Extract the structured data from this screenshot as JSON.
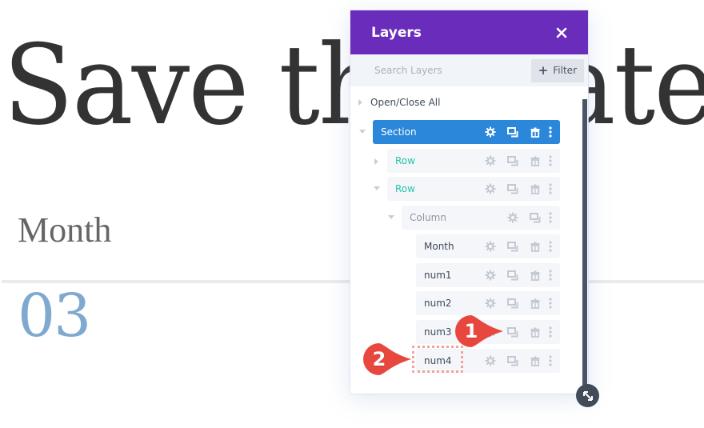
{
  "page": {
    "title": "Save the Date",
    "month_label": "Month",
    "day_number": "03"
  },
  "layers_panel": {
    "title": "Layers",
    "close_icon": "close-icon",
    "search": {
      "placeholder": "Search Layers",
      "value": ""
    },
    "filter_label": "Filter",
    "open_close_label": "Open/Close All",
    "colors": {
      "header": "#6a2dbb",
      "selected": "#2b87da",
      "row_label": "#29c4a9",
      "callout": "#e8473d"
    },
    "tree": [
      {
        "label": "Section",
        "type": "section",
        "level": 0,
        "expanded": true,
        "selected": true,
        "actions": [
          "settings",
          "duplicate",
          "delete",
          "more"
        ]
      },
      {
        "label": "Row",
        "type": "row",
        "level": 1,
        "expanded": false,
        "selected": false,
        "actions": [
          "settings",
          "duplicate",
          "delete",
          "more"
        ]
      },
      {
        "label": "Row",
        "type": "row",
        "level": 1,
        "expanded": true,
        "selected": false,
        "actions": [
          "settings",
          "duplicate",
          "delete",
          "more"
        ]
      },
      {
        "label": "Column",
        "type": "column",
        "level": 2,
        "expanded": true,
        "selected": false,
        "actions": [
          "settings",
          "duplicate",
          "more"
        ]
      },
      {
        "label": "Month",
        "type": "module",
        "level": 3,
        "selected": false,
        "actions": [
          "settings",
          "duplicate",
          "delete",
          "more"
        ]
      },
      {
        "label": "num1",
        "type": "module",
        "level": 3,
        "selected": false,
        "actions": [
          "settings",
          "duplicate",
          "delete",
          "more"
        ]
      },
      {
        "label": "num2",
        "type": "module",
        "level": 3,
        "selected": false,
        "actions": [
          "settings",
          "duplicate",
          "delete",
          "more"
        ]
      },
      {
        "label": "num3",
        "type": "module",
        "level": 3,
        "selected": false,
        "actions": [
          "settings",
          "duplicate",
          "delete",
          "more"
        ]
      },
      {
        "label": "num4",
        "type": "module",
        "level": 3,
        "selected": false,
        "actions": [
          "settings",
          "duplicate",
          "delete",
          "more"
        ]
      }
    ]
  },
  "annotations": [
    {
      "number": "1",
      "points_to": "num3 duplicate icon"
    },
    {
      "number": "2",
      "points_to": "num4 layer"
    }
  ]
}
